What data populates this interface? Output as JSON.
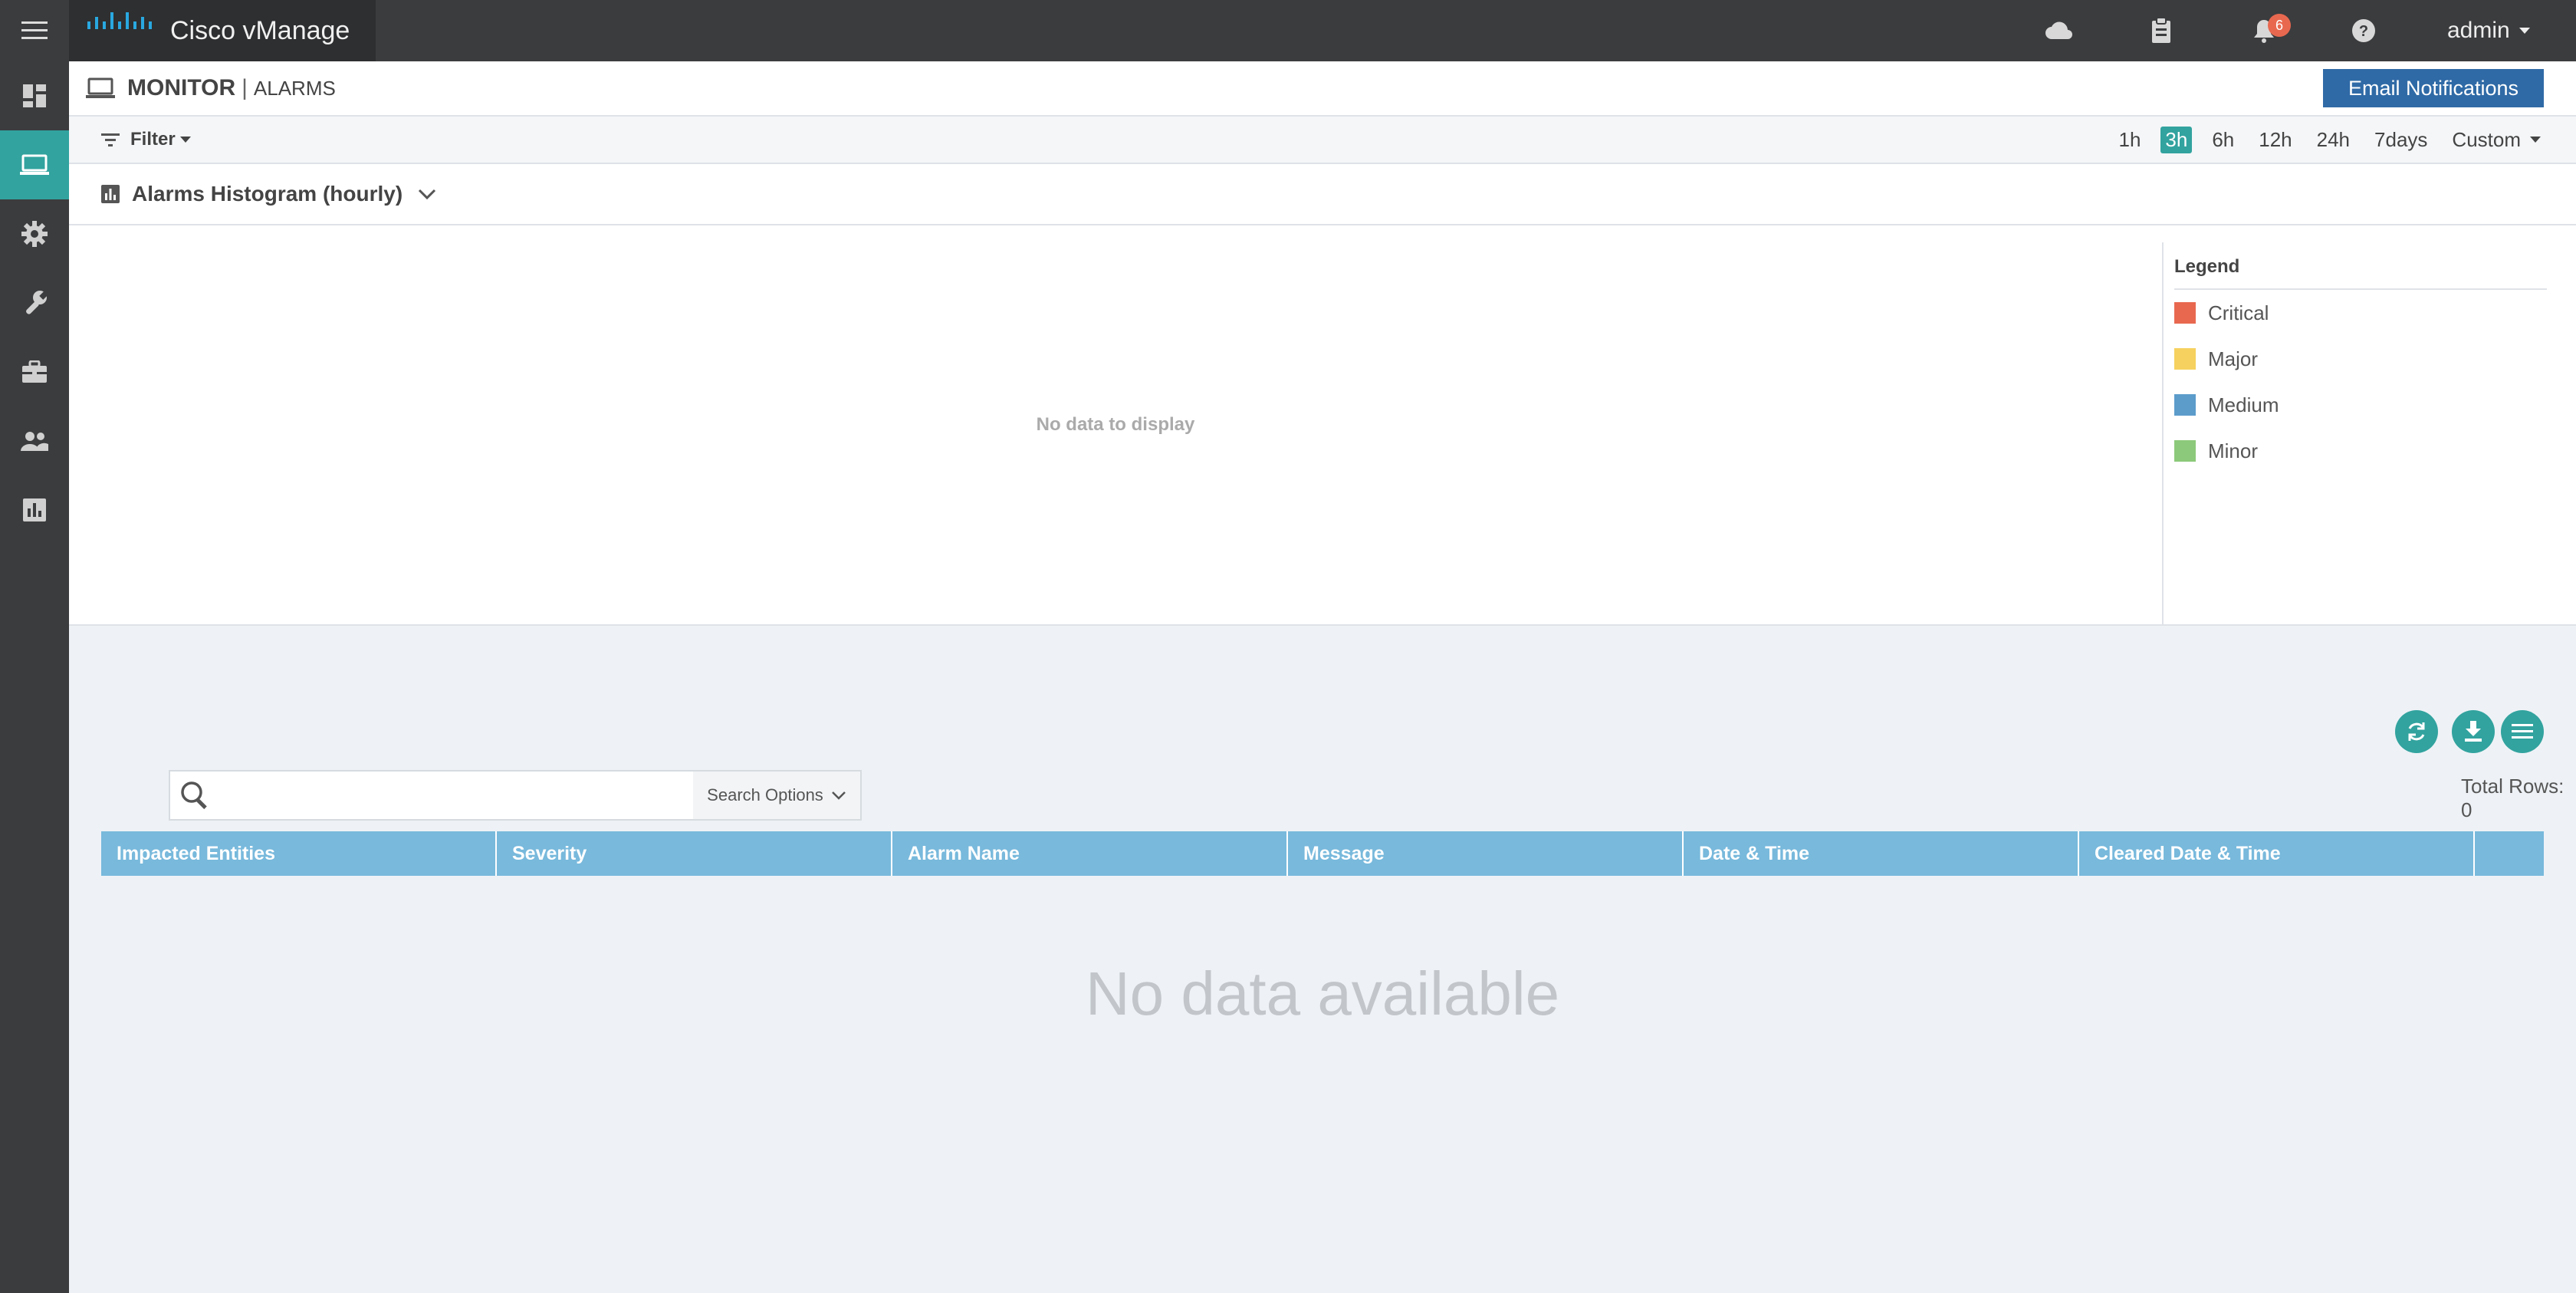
{
  "app": {
    "logo_text": "CISCO",
    "title": "Cisco vManage"
  },
  "topbar": {
    "notification_count": "6",
    "user": "admin",
    "icons": [
      "menu-icon",
      "cloud-icon",
      "clipboard-icon",
      "bell-icon",
      "help-icon"
    ]
  },
  "sidebar": {
    "items": [
      {
        "name": "dashboard",
        "icon": "dashboard-icon",
        "active": false
      },
      {
        "name": "monitor",
        "icon": "monitor-icon",
        "active": true
      },
      {
        "name": "configuration",
        "icon": "gear-icon",
        "active": false
      },
      {
        "name": "tools",
        "icon": "wrench-icon",
        "active": false
      },
      {
        "name": "maintenance",
        "icon": "briefcase-icon",
        "active": false
      },
      {
        "name": "administration",
        "icon": "users-icon",
        "active": false
      },
      {
        "name": "analytics",
        "icon": "analytics-icon",
        "active": false
      }
    ]
  },
  "header": {
    "section": "MONITOR",
    "separator": "|",
    "page": "ALARMS",
    "email_button": "Email Notifications"
  },
  "filter": {
    "label": "Filter"
  },
  "time_ranges": {
    "options": [
      "1h",
      "3h",
      "6h",
      "12h",
      "24h",
      "7days",
      "Custom"
    ],
    "selected": "3h"
  },
  "histogram": {
    "title": "Alarms Histogram (hourly)",
    "empty_text": "No data to display",
    "legend_title": "Legend",
    "legend": [
      {
        "label": "Critical",
        "color": "#e8684f"
      },
      {
        "label": "Major",
        "color": "#f6d15f"
      },
      {
        "label": "Medium",
        "color": "#5c9ccb"
      },
      {
        "label": "Minor",
        "color": "#8cc97a"
      }
    ]
  },
  "table": {
    "search_placeholder": "",
    "search_options_label": "Search Options",
    "total_rows_label": "Total Rows: 0",
    "columns": [
      "Impacted Entities",
      "Severity",
      "Alarm Name",
      "Message",
      "Date & Time",
      "Cleared Date & Time"
    ],
    "empty_text": "No data available"
  },
  "colors": {
    "accent": "#32a39f",
    "primary_button": "#2f6aa6",
    "table_header": "#78b9dc"
  }
}
